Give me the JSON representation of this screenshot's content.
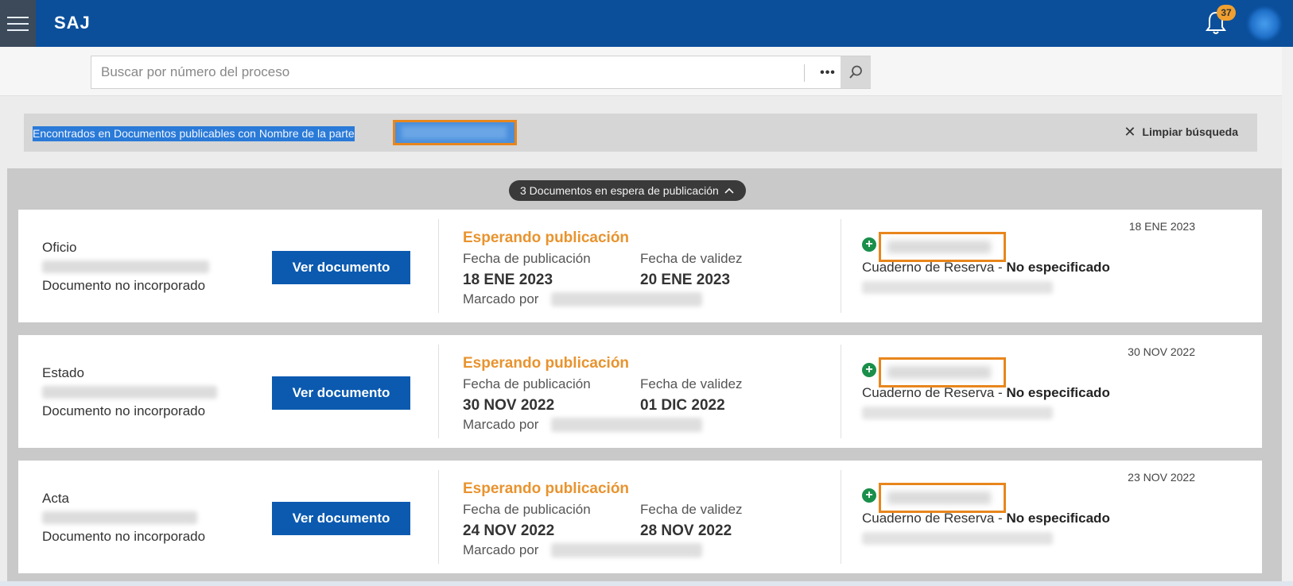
{
  "header": {
    "logo": "SAJ",
    "notification_count": "37"
  },
  "search": {
    "placeholder": "Buscar por número del proceso",
    "more_label": "•••"
  },
  "filter": {
    "text": "Encontrados en Documentos publicables con Nombre de la parte",
    "clear_label": "Limpiar búsqueda"
  },
  "pending": {
    "label": "3 Documentos en espera de publicación"
  },
  "labels": {
    "view_button": "Ver documento",
    "publication_date": "Fecha de publicación",
    "validity_date": "Fecha de validez",
    "marked_by": "Marcado por",
    "notebook_prefix": "Cuaderno de Reserva -",
    "notebook_value": "No especificado"
  },
  "documents": [
    {
      "type": "Oficio",
      "status_text": "Documento no incorporado",
      "publication_status": "Esperando publicación",
      "publication_date": "18 ENE 2023",
      "validity_date": "20 ENE 2023",
      "date": "18 ENE 2023"
    },
    {
      "type": "Estado",
      "status_text": "Documento no incorporado",
      "publication_status": "Esperando publicación",
      "publication_date": "30 NOV 2022",
      "validity_date": "01 DIC 2022",
      "date": "30 NOV 2022"
    },
    {
      "type": "Acta",
      "status_text": "Documento no incorporado",
      "publication_status": "Esperando publicación",
      "publication_date": "24 NOV 2022",
      "validity_date": "28 NOV 2022",
      "date": "23 NOV 2022"
    }
  ],
  "colors": {
    "header": "#0b4f9b",
    "button": "#0b5ab0",
    "status": "#e8932e",
    "highlight": "#e8861c",
    "plus": "#1a8f4a"
  },
  "icons": {
    "menu": "hamburger-menu-icon",
    "bell": "bell-icon",
    "search": "search-icon",
    "clear": "close-icon",
    "chevron": "chevron-up-icon",
    "add": "plus-circle-icon"
  }
}
